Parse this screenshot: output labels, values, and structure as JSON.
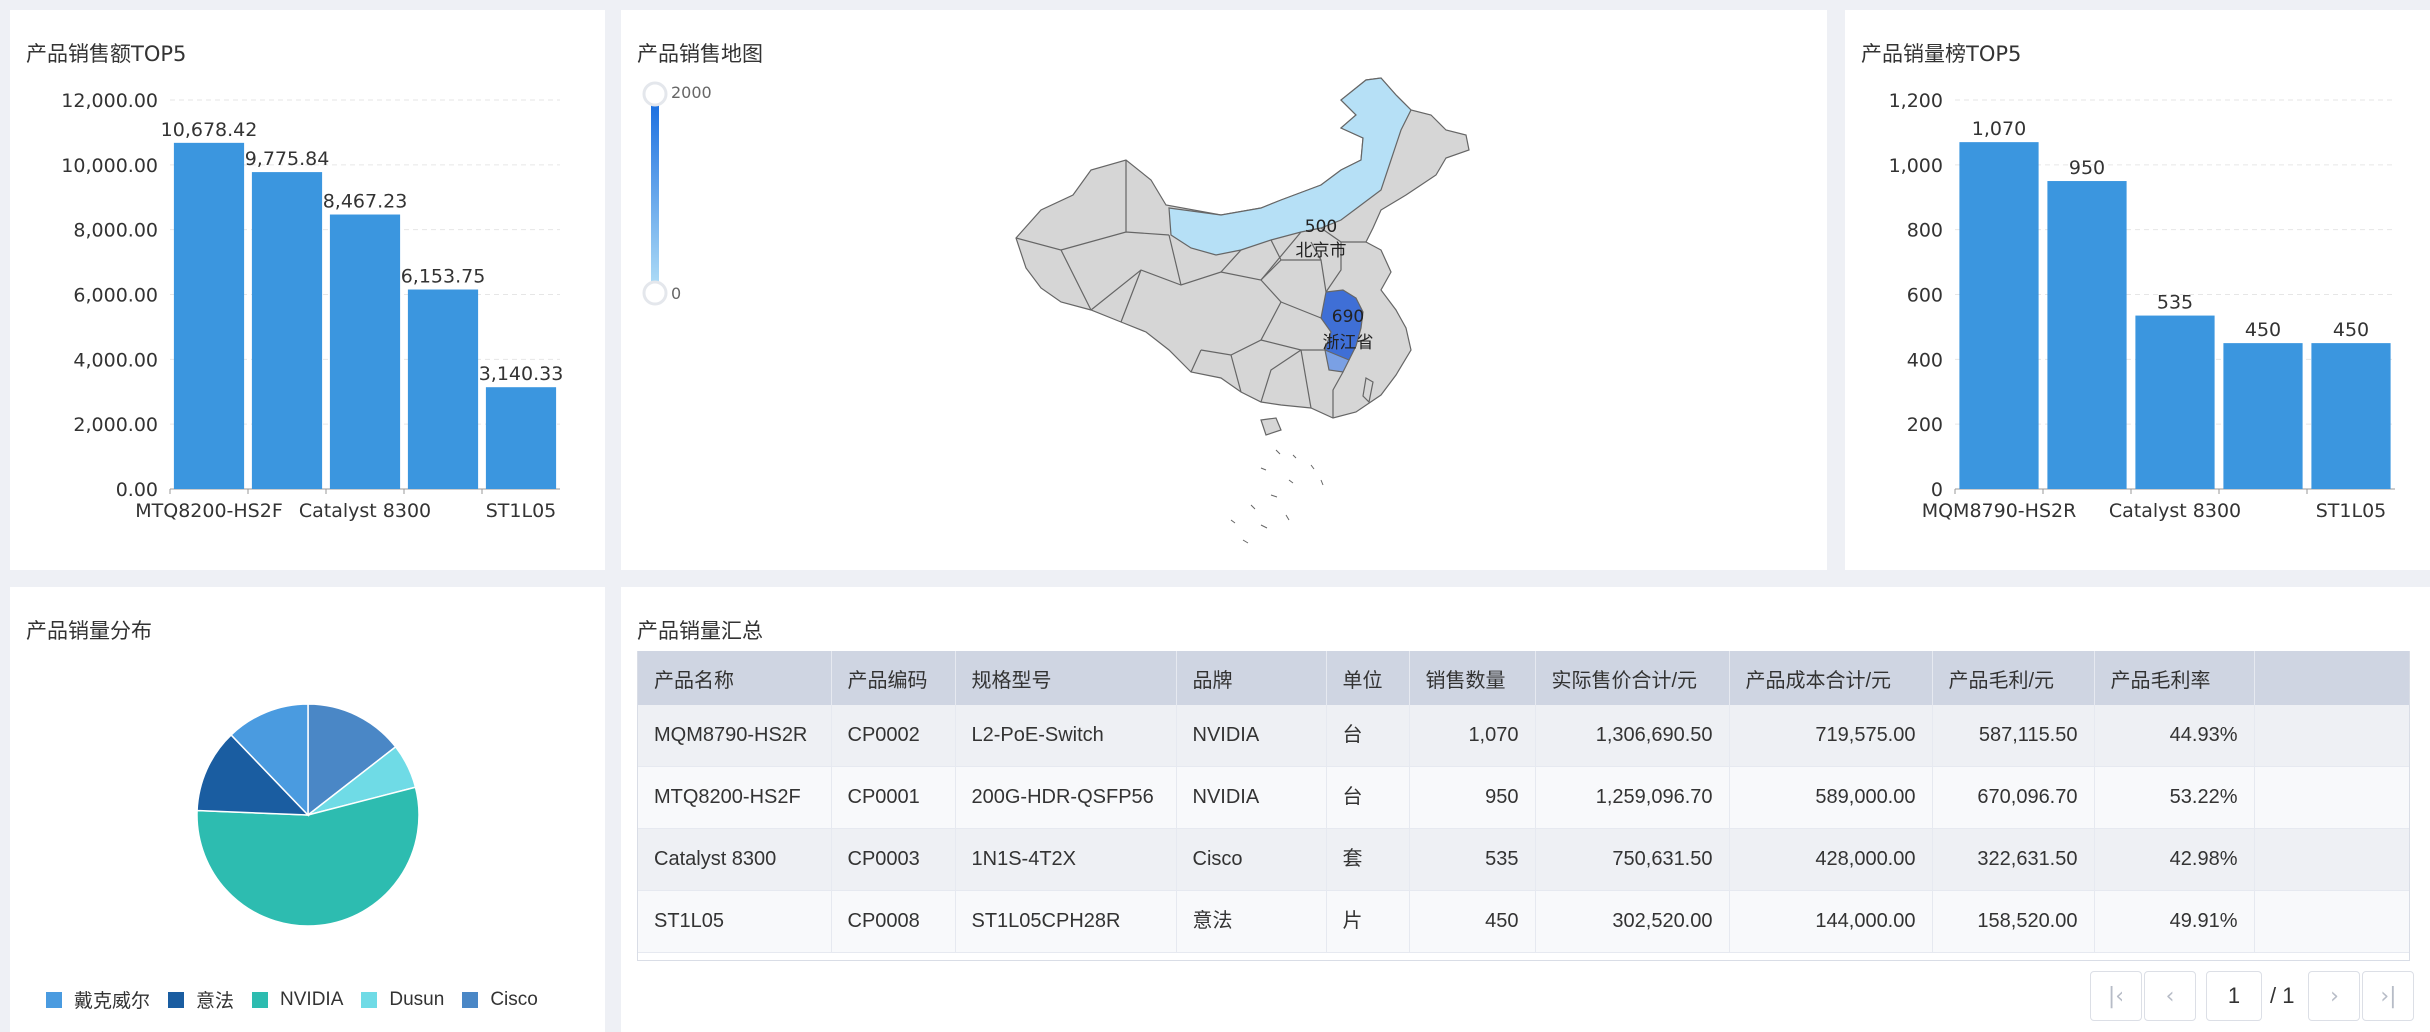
{
  "cards": {
    "sales_amount_top5": {
      "title": "产品销售额TOP5"
    },
    "sales_map": {
      "title": "产品销售地图"
    },
    "sales_volume_top5": {
      "title": "产品销量榜TOP5"
    },
    "sales_distribution": {
      "title": "产品销量分布"
    },
    "sales_summary": {
      "title": "产品销量汇总"
    }
  },
  "chart_data": [
    {
      "type": "bar",
      "title": "产品销售额TOP5",
      "categories": [
        "MTQ8200-HS2F",
        "",
        "Catalyst 8300",
        "",
        "ST1L05"
      ],
      "values": [
        10678.42,
        9775.84,
        8467.23,
        6153.75,
        3140.33
      ],
      "value_labels": [
        "10,678.42",
        "9,775.84",
        "8,467.23",
        "6,153.75",
        "3,140.33"
      ],
      "y_ticks": [
        "0.00",
        "2,000.00",
        "4,000.00",
        "6,000.00",
        "8,000.00",
        "10,000.00",
        "12,000.00"
      ],
      "ylim": [
        0,
        12000
      ],
      "color": "#3b96df",
      "grid": true
    },
    {
      "type": "bar",
      "title": "产品销量榜TOP5",
      "categories": [
        "MQM8790-HS2R",
        "",
        "Catalyst 8300",
        "",
        "ST1L05"
      ],
      "values": [
        1070,
        950,
        535,
        450,
        450
      ],
      "value_labels": [
        "1,070",
        "950",
        "535",
        "450",
        "450"
      ],
      "y_ticks": [
        "0",
        "200",
        "400",
        "600",
        "800",
        "1,000",
        "1,200"
      ],
      "ylim": [
        0,
        1200
      ],
      "color": "#3b96df",
      "grid": true
    },
    {
      "type": "pie",
      "title": "产品销量分布",
      "series": [
        {
          "name": "戴克威尔",
          "value": 450,
          "color": "#4a9be0"
        },
        {
          "name": "意法",
          "value": 450,
          "color": "#1a5da1"
        },
        {
          "name": "NVIDIA",
          "value": 2020,
          "color": "#2dbcb0"
        },
        {
          "name": "Dusun",
          "value": 240,
          "color": "#6fdbe6"
        },
        {
          "name": "Cisco",
          "value": 535,
          "color": "#4a87c6"
        }
      ],
      "legend_position": "bottom"
    }
  ],
  "map": {
    "visual_map": {
      "max_label": "2000",
      "min_label": "0"
    },
    "regions": [
      {
        "name": "北京市",
        "value": "500"
      },
      {
        "name": "浙江省",
        "value": "690"
      }
    ]
  },
  "table": {
    "columns": [
      "产品名称",
      "产品编码",
      "规格型号",
      "品牌",
      "单位",
      "销售数量",
      "实际售价合计/元",
      "产品成本合计/元",
      "产品毛利/元",
      "产品毛利率",
      ""
    ],
    "rows": [
      [
        "MQM8790-HS2R",
        "CP0002",
        "L2-PoE-Switch",
        "NVIDIA",
        "台",
        "1,070",
        "1,306,690.50",
        "719,575.00",
        "587,115.50",
        "44.93%",
        ""
      ],
      [
        "MTQ8200-HS2F",
        "CP0001",
        "200G-HDR-QSFP56",
        "NVIDIA",
        "台",
        "950",
        "1,259,096.70",
        "589,000.00",
        "670,096.70",
        "53.22%",
        ""
      ],
      [
        "Catalyst 8300",
        "CP0003",
        "1N1S-4T2X",
        "Cisco",
        "套",
        "535",
        "750,631.50",
        "428,000.00",
        "322,631.50",
        "42.98%",
        ""
      ],
      [
        "ST1L05",
        "CP0008",
        "ST1L05CPH28R",
        "意法",
        "片",
        "450",
        "302,520.00",
        "144,000.00",
        "158,520.00",
        "49.91%",
        ""
      ]
    ]
  },
  "pager": {
    "current": "1",
    "total": "/ 1"
  },
  "icons": {
    "first": "first-page-icon",
    "prev": "prev-page-icon",
    "next": "next-page-icon",
    "last": "last-page-icon"
  }
}
